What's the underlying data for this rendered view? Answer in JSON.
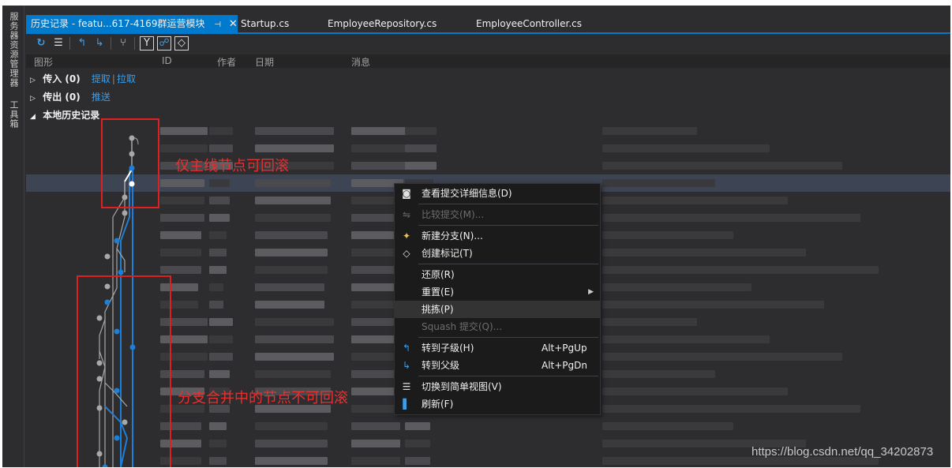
{
  "side_strip": {
    "tab1": "服务器资源管理器",
    "tab2": "工具箱"
  },
  "tabs": [
    {
      "label": "历史记录 - featu...617-4169群运营模块",
      "active": true,
      "pin_icon": "pin-icon",
      "close_icon": "close-icon"
    },
    {
      "label": "Startup.cs",
      "active": false
    },
    {
      "label": "EmployeeRepository.cs",
      "active": false
    },
    {
      "label": "EmployeeController.cs",
      "active": false
    }
  ],
  "toolbar": {
    "icons": [
      "refresh-icon",
      "list-view-icon",
      "goto-child-icon",
      "goto-parent-icon",
      "branch-graph-icon",
      "show-merge-icon",
      "show-remote-icon",
      "tag-icon"
    ]
  },
  "columns": [
    "图形",
    "ID",
    "作者",
    "日期",
    "消息"
  ],
  "sections": {
    "incoming": {
      "label": "传入 (0)",
      "links": [
        "提取",
        "拉取"
      ]
    },
    "outgoing": {
      "label": "传出 (0)",
      "links": [
        "推送"
      ]
    },
    "local": {
      "label": "本地历史记录"
    }
  },
  "annotations": {
    "text1": "仅主线节点可回滚",
    "text2": "分支合并中的节点不可回滚"
  },
  "context_menu": {
    "items": [
      {
        "label": "查看提交详细信息(D)",
        "icon": "commit-details-icon",
        "shortcut": "",
        "disabled": false
      },
      {
        "label": "比较提交(M)...",
        "icon": "compare-icon",
        "shortcut": "",
        "disabled": true
      },
      {
        "label": "新建分支(N)...",
        "icon": "new-branch-icon",
        "shortcut": "",
        "disabled": false
      },
      {
        "label": "创建标记(T)",
        "icon": "tag-icon",
        "shortcut": "",
        "disabled": false
      },
      {
        "label": "还原(R)",
        "icon": "",
        "shortcut": "",
        "disabled": false
      },
      {
        "label": "重置(E)",
        "icon": "",
        "shortcut": "",
        "disabled": false,
        "submenu": true
      },
      {
        "label": "挑拣(P)",
        "icon": "",
        "shortcut": "",
        "disabled": false,
        "hover": true
      },
      {
        "label": "Squash 提交(Q)...",
        "icon": "",
        "shortcut": "",
        "disabled": true
      },
      {
        "label": "转到子级(H)",
        "icon": "goto-child-icon",
        "shortcut": "Alt+PgUp",
        "disabled": false
      },
      {
        "label": "转到父级",
        "icon": "goto-parent-icon",
        "shortcut": "Alt+PgDn",
        "disabled": false
      },
      {
        "label": "切换到简单视图(V)",
        "icon": "simple-view-icon",
        "shortcut": "",
        "disabled": false
      },
      {
        "label": "刷新(F)",
        "icon": "refresh-icon",
        "shortcut": "",
        "disabled": false
      }
    ]
  },
  "watermark": "https://blog.csdn.net/qq_34202873",
  "colors": {
    "accent": "#007acc",
    "graph_main": "#1e7fd6",
    "graph_node_grey": "#a8a8a8",
    "annotation": "#e02020",
    "link": "#3e9de5"
  }
}
